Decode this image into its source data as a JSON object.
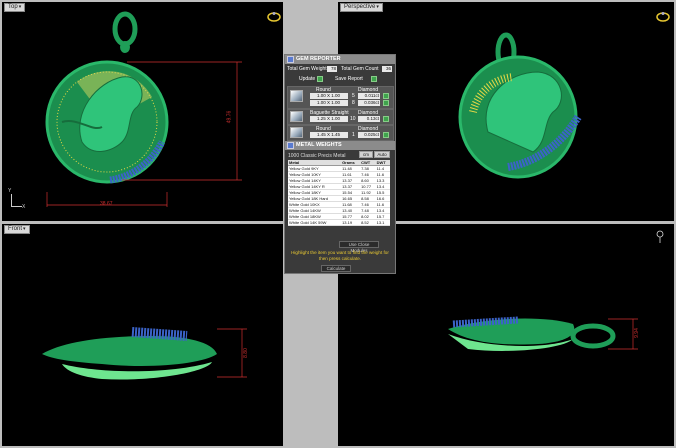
{
  "viewports": {
    "top": {
      "label": "Top"
    },
    "perspective": {
      "label": "Perspective"
    },
    "front": {
      "label": "Front"
    },
    "right": {
      "label": ""
    }
  },
  "dimensions": {
    "top_vertical": "49.76",
    "top_horizontal": "38.67",
    "front_height": "8.80",
    "right_height": "9.94"
  },
  "axis_labels": {
    "x": "X",
    "y": "Y"
  },
  "gem_reporter": {
    "title": "GEM REPORTER",
    "total_weight_label": "Total Gem Weight",
    "total_weight": "78",
    "total_count_label": "Total Gem Count",
    "total_count": "36",
    "update_label": "Update",
    "save_report_label": "Save Report",
    "gems": [
      {
        "shape": "Round",
        "material": "Diamond",
        "size1": "1.00 X 1.00",
        "count1": "5",
        "weight1": "0.011ct",
        "size2": "1.00 X 1.00",
        "count2": "8",
        "weight2": "0.036ct"
      },
      {
        "shape": "Baguette Straight",
        "material": "Diamond",
        "size1": "1.25 X 1.00",
        "count1": "10",
        "weight1": "0.13ct"
      },
      {
        "shape": "Round",
        "material": "Diamond",
        "size1": "1.45 X 1.45",
        "count1": "1",
        "weight1": "0.025ct"
      }
    ]
  },
  "metal_weights": {
    "title": "METAL WEIGHTS",
    "calc_label": "1000 Classic Precis Metal",
    "units": "cm",
    "unit_select": "Auto",
    "columns": [
      "Metal",
      "Grams",
      "CWT",
      "DWT"
    ],
    "rows": [
      [
        "Yellow Gold 9KY",
        "11.48",
        "7.38",
        "11.4"
      ],
      [
        "Yellow Gold 10KY",
        "11.61",
        "7.46",
        "11.6"
      ],
      [
        "Yellow Gold 14KY",
        "13.37",
        "8.60",
        "13.3"
      ],
      [
        "Yellow Gold 14KY R",
        "13.37",
        "10.77",
        "13.4"
      ],
      [
        "Yellow Gold 18KY",
        "15.54",
        "11.92",
        "15.5"
      ],
      [
        "Yellow Gold 18K Hard",
        "16.65",
        "8.58",
        "16.6"
      ],
      [
        "White Gold 10KX",
        "11.68",
        "7.46",
        "11.6"
      ],
      [
        "White Gold 14KW",
        "13.40",
        "7.48",
        "13.4"
      ],
      [
        "White Gold 18KW",
        "15.77",
        "8.02",
        "15.7"
      ],
      [
        "White Gold 14K 59W",
        "13.19",
        "8.52",
        "13.1"
      ]
    ],
    "dropdown": "Use Close Modules",
    "note": "Highlight the item you want to find the weight for then press calculate.",
    "calculate_label": "Calculate"
  },
  "colors": {
    "jewel": "#1f9e58",
    "jewel_light": "#6ee58f",
    "gem": "#3b63c8",
    "dim": "#d03030",
    "yellow": "#e8d845"
  }
}
